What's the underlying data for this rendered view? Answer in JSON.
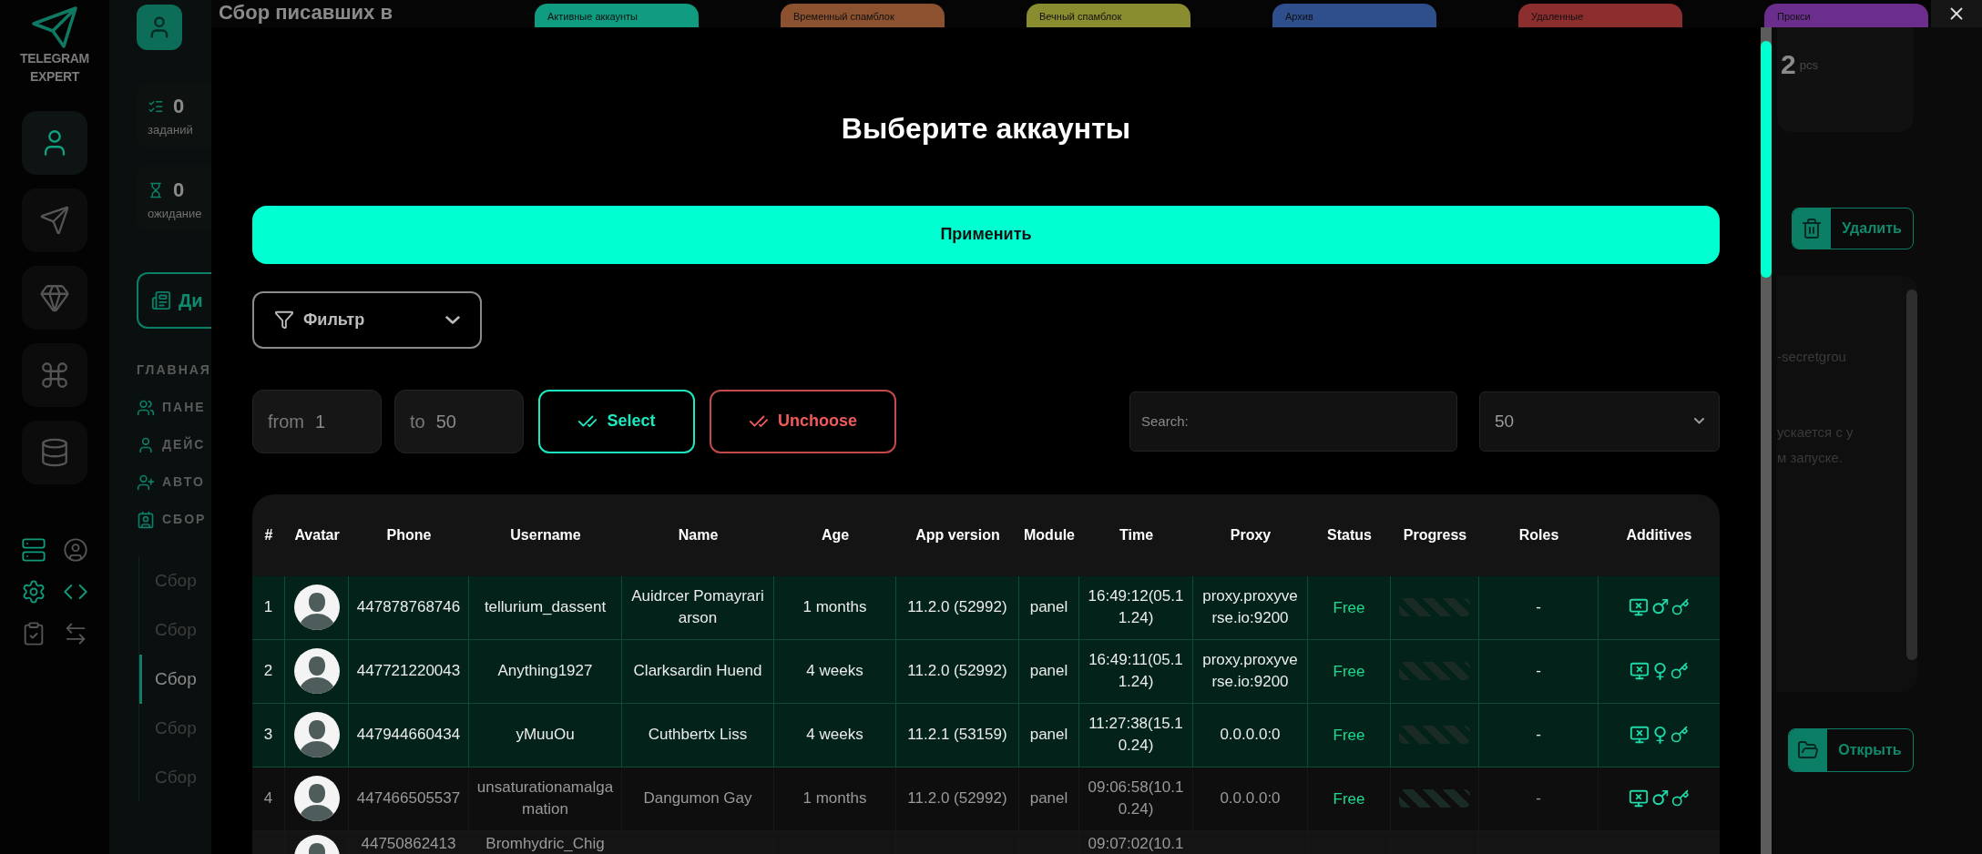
{
  "sidebar": {
    "logo_lines": [
      "TELEGRAM",
      "EXPERT"
    ],
    "nav_buttons": [
      {
        "selected": true
      },
      {
        "selected": false
      },
      {
        "selected": false
      },
      {
        "selected": false
      },
      {
        "selected": false
      }
    ]
  },
  "page_header": {
    "title": "Сбор писавших в"
  },
  "stats": [
    {
      "value": "0",
      "label": "заданий"
    },
    {
      "value": "0",
      "label": "ожидание"
    }
  ],
  "dashboard_button": "Ди",
  "menu": {
    "heading": "ГЛАВНАЯ",
    "items": [
      {
        "label": "ПАНЕ"
      },
      {
        "label": "ДЕЙС"
      },
      {
        "label": "АВТО"
      },
      {
        "label": "СБОР",
        "children": [
          {
            "label": "Сбор",
            "selected": false
          },
          {
            "label": "Сбор",
            "selected": false
          },
          {
            "label": "Сбор",
            "selected": true
          },
          {
            "label": "Сбор",
            "selected": false
          },
          {
            "label": "Сбор",
            "selected": false
          }
        ]
      }
    ]
  },
  "status_tabs": [
    {
      "label": "Активные аккаунты",
      "color": "#0f9c80"
    },
    {
      "label": "Временный спамблок",
      "color": "#8c5230"
    },
    {
      "label": "Вечный спамблок",
      "color": "#8a8c30"
    },
    {
      "label": "Архив",
      "color": "#2e4f8c"
    },
    {
      "label": "Удаленные",
      "color": "#8c2e2e"
    },
    {
      "label": "Прокси",
      "color": "#6c2e8c"
    }
  ],
  "modal": {
    "title": "Выберите аккаунты",
    "apply_button": "Применить",
    "filter": {
      "label": "Фильтр"
    },
    "range": {
      "from_label": "from",
      "from_value": "1",
      "to_label": "to",
      "to_value": "50"
    },
    "select_button": "Select",
    "unchoose_button": "Unchoose",
    "search": {
      "placeholder": "Search:"
    },
    "page_size": "50",
    "table": {
      "columns": [
        "#",
        "Avatar",
        "Phone",
        "Username",
        "Name",
        "Age",
        "App version",
        "Module",
        "Time",
        "Proxy",
        "Status",
        "Progress",
        "Roles",
        "Additives"
      ],
      "rows": [
        {
          "index": "1",
          "phone": "447878768746",
          "username": "tellurium_dassent",
          "name": "Auidrcer Pomayrariarson",
          "age": "1 months",
          "app_version": "11.2.0 (52992)",
          "module": "panel",
          "time": "16:49:12(05.11.24)",
          "proxy": "proxy.proxyverse.io:9200",
          "status": "Free",
          "roles": "-",
          "gender_sign": "♂",
          "selected": true
        },
        {
          "index": "2",
          "phone": "447721220043",
          "username": "Anything1927",
          "name": "Clarksardin Huend",
          "age": "4 weeks",
          "app_version": "11.2.0 (52992)",
          "module": "panel",
          "time": "16:49:11(05.11.24)",
          "proxy": "proxy.proxyverse.io:9200",
          "status": "Free",
          "roles": "-",
          "gender_sign": "♀",
          "selected": true
        },
        {
          "index": "3",
          "phone": "447944660434",
          "username": "yMuuOu",
          "name": "Cuthbertx Liss",
          "age": "4 weeks",
          "app_version": "11.2.1 (53159)",
          "module": "panel",
          "time": "11:27:38(15.10.24)",
          "proxy": "0.0.0.0:0",
          "status": "Free",
          "roles": "-",
          "gender_sign": "♀",
          "selected": true
        },
        {
          "index": "4",
          "phone": "447466505537",
          "username": "unsaturationamalgamation",
          "name": "Dangumon Gay",
          "age": "1 months",
          "app_version": "11.2.0 (52992)",
          "module": "panel",
          "time": "09:06:58(10.10.24)",
          "proxy": "0.0.0.0:0",
          "status": "Free",
          "roles": "-",
          "gender_sign": "♂",
          "selected": false
        },
        {
          "phone": "44750862413",
          "username": "Bromhydric_Chig",
          "time": "09:07:02(10.1",
          "selected": false
        }
      ]
    }
  },
  "right_panel": {
    "count": "2",
    "count_unit": "pcs",
    "delete_button": "Удалить",
    "log_lines": [
      "-secretgrou",
      "ускается с у",
      "м запуске."
    ],
    "open_button": "Открыть"
  }
}
